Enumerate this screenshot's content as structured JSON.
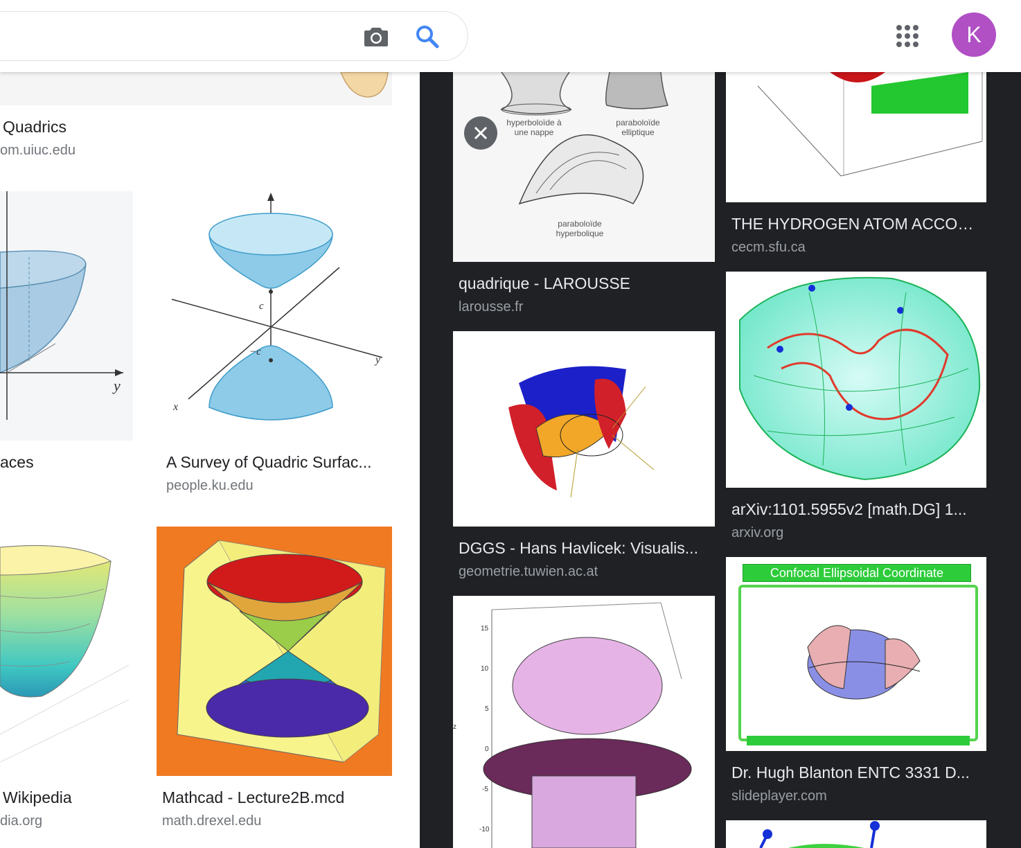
{
  "search": {
    "query": "",
    "placeholder": ""
  },
  "header": {
    "avatar_letter": "K"
  },
  "left_results": [
    {
      "title": "Quadrics",
      "source": "om.uiuc.edu"
    },
    {
      "title": "aces",
      "source": ""
    },
    {
      "title": "A Survey of Quadric Surfac...",
      "source": "people.ku.edu"
    },
    {
      "title": "Wikipedia",
      "source": "dia.org"
    },
    {
      "title": "Mathcad - Lecture2B.mcd",
      "source": "math.drexel.edu"
    }
  ],
  "right_results": [
    {
      "title": "quadrique - LAROUSSE",
      "source": "larousse.fr",
      "image_labels": [
        "hyperboloïde à une nappe",
        "paraboloïde elliptique",
        "paraboloïde hyperbolique"
      ]
    },
    {
      "title": "DGGS - Hans Havlicek: Visualis...",
      "source": "geometrie.tuwien.ac.at"
    },
    {
      "title": "THE HYDROGEN ATOM ACCOR...",
      "source": "cecm.sfu.ca"
    },
    {
      "title": "arXiv:1101.5955v2 [math.DG] 1...",
      "source": "arxiv.org"
    },
    {
      "title": "Dr. Hugh Blanton ENTC 3331 D...",
      "source": "slideplayer.com",
      "image_labels": [
        "Confocal Ellipsoidal Coordinate"
      ]
    }
  ],
  "colors": {
    "dark_panel": "#202124",
    "avatar": "#b14fc5",
    "search_blue": "#4285f4",
    "icon_gray": "#5f6368"
  }
}
